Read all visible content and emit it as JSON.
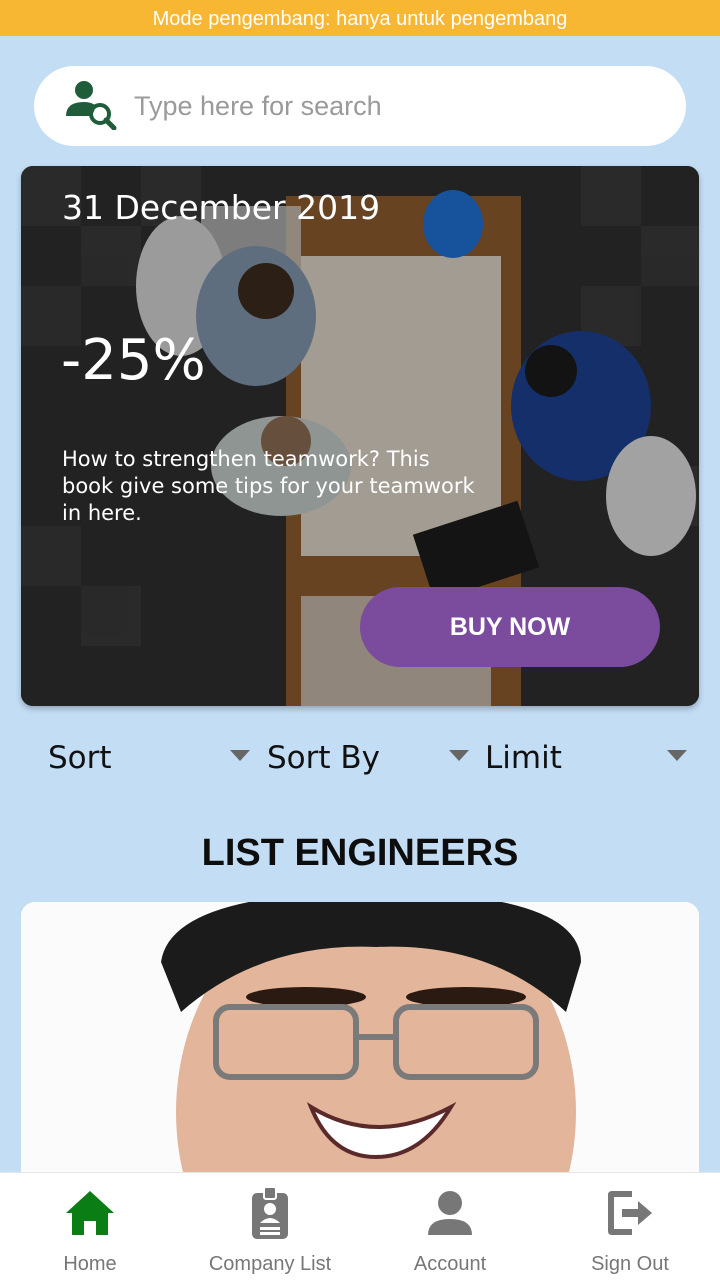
{
  "dev_banner": "Mode pengembang: hanya untuk pengembang",
  "search": {
    "placeholder": "Type here for search",
    "value": "",
    "icon": "user-search-icon"
  },
  "promo": {
    "date": "31 December 2019",
    "discount": "-25%",
    "description": "How to strengthen teamwork? This book give some tips for your teamwork in here.",
    "button_label": "BUY NOW",
    "button_color": "#7b4b9e"
  },
  "filters": [
    {
      "label": "Sort"
    },
    {
      "label": "Sort By"
    },
    {
      "label": "Limit"
    }
  ],
  "section_title": "LIST ENGINEERS",
  "bottom_nav": [
    {
      "label": "Home",
      "icon": "home-icon",
      "active": true,
      "color": "#0a7d14"
    },
    {
      "label": "Company List",
      "icon": "id-badge-icon",
      "active": false,
      "color": "#777777"
    },
    {
      "label": "Account",
      "icon": "person-icon",
      "active": false,
      "color": "#777777"
    },
    {
      "label": "Sign Out",
      "icon": "sign-out-icon",
      "active": false,
      "color": "#777777"
    }
  ],
  "colors": {
    "background": "#c3ddf5",
    "banner": "#f7b733",
    "icon_green": "#1f5c3a"
  }
}
